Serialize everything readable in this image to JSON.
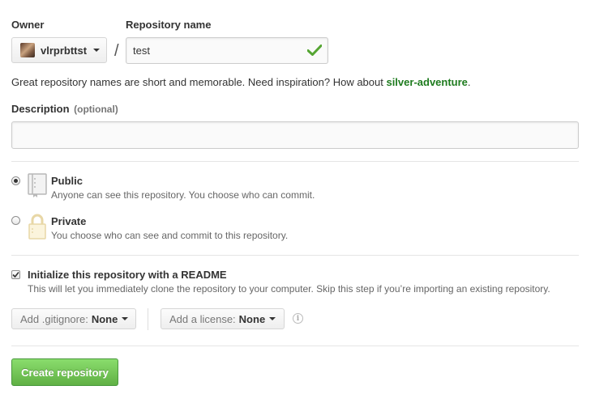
{
  "owner": {
    "label": "Owner",
    "username": "vlrprbttst"
  },
  "repo_name": {
    "label": "Repository name",
    "value": "test",
    "valid": true
  },
  "separator": "/",
  "name_hint": {
    "text": "Great repository names are short and memorable. Need inspiration? How about ",
    "suggestion": "silver-adventure",
    "suffix": "."
  },
  "description": {
    "label": "Description",
    "optional": "(optional)",
    "value": ""
  },
  "visibility": {
    "selected": "public",
    "options": [
      {
        "id": "public",
        "title": "Public",
        "note": "Anyone can see this repository. You choose who can commit.",
        "icon": "repo-book-icon"
      },
      {
        "id": "private",
        "title": "Private",
        "note": "You choose who can see and commit to this repository.",
        "icon": "lock-icon"
      }
    ]
  },
  "readme": {
    "checked": true,
    "title": "Initialize this repository with a README",
    "note": "This will let you immediately clone the repository to your computer. Skip this step if you’re importing an existing repository."
  },
  "gitignore": {
    "label": "Add .gitignore:",
    "value": "None"
  },
  "license": {
    "label": "Add a license:",
    "value": "None"
  },
  "info_glyph": "i",
  "submit": {
    "label": "Create repository"
  },
  "colors": {
    "accent_green": "#60b044",
    "suggestion_green": "#1e7b1e",
    "check_green": "#55a532"
  }
}
